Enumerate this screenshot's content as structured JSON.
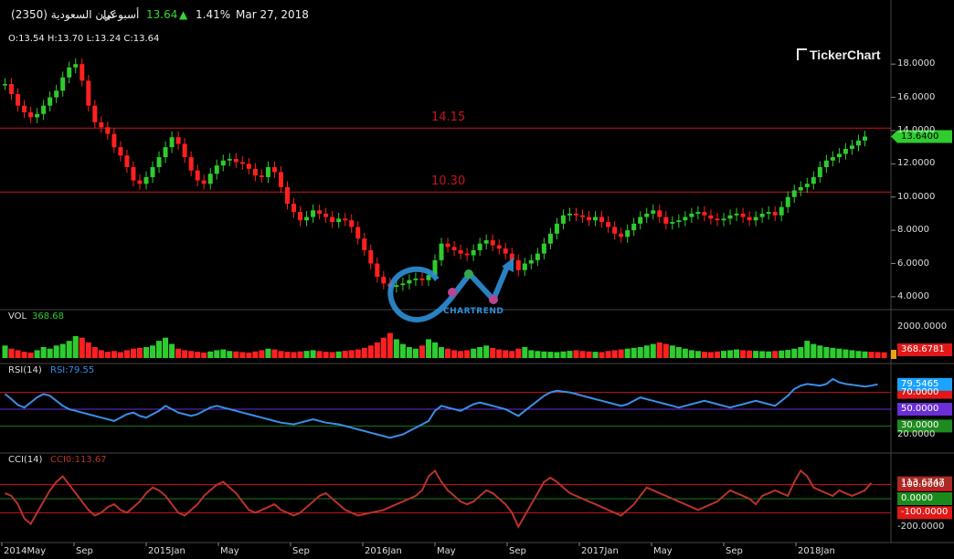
{
  "header": {
    "name": "كيان السعودية (2350)",
    "period": "أسبوعي",
    "price": "13.64",
    "change": "1.41%",
    "date": "Mar 27, 2018"
  },
  "ohlc": {
    "o": "O:13.54",
    "h": "H:13.70",
    "l": "L:13.24",
    "c": "C:13.64"
  },
  "brand": "TickerChart",
  "watermark": "CHARTREND",
  "colors": {
    "up": "#2ecc2e",
    "down": "#ff2020",
    "rsi": "#3a8ee6",
    "cci": "#b8332c",
    "level": "#c8141e"
  },
  "chart_data": {
    "type": "candlestick",
    "x_labels": [
      "2014May",
      "Sep",
      "2015Jan",
      "May",
      "Sep",
      "2016Jan",
      "May",
      "Sep",
      "2017Jan",
      "May",
      "Sep",
      "2018Jan"
    ],
    "price": {
      "y_ticks": [
        "18.0000",
        "16.0000",
        "14.0000",
        "12.0000",
        "10.0000",
        "8.0000",
        "6.0000",
        "4.0000"
      ],
      "ylim": [
        3.5,
        19
      ],
      "last_value": "13.6400",
      "levels": [
        {
          "label": "14.15",
          "value": 14.15
        },
        {
          "label": "10.30",
          "value": 10.3
        }
      ],
      "series": [
        16.8,
        16.2,
        15.5,
        15.1,
        14.8,
        15.0,
        15.5,
        16.0,
        16.4,
        17.2,
        17.8,
        18.0,
        17.0,
        15.5,
        14.5,
        14.2,
        13.8,
        13.0,
        12.5,
        11.8,
        11.0,
        10.8,
        11.2,
        11.8,
        12.4,
        13.0,
        13.6,
        13.2,
        12.4,
        11.6,
        11.0,
        10.8,
        11.4,
        11.9,
        12.2,
        12.3,
        12.1,
        12.0,
        11.7,
        11.3,
        11.2,
        11.8,
        11.5,
        10.6,
        9.6,
        9.1,
        8.6,
        8.8,
        9.2,
        9.0,
        8.8,
        8.5,
        8.7,
        8.6,
        8.2,
        7.5,
        6.8,
        6.0,
        5.2,
        4.8,
        4.6,
        4.7,
        4.8,
        5.0,
        5.1,
        5.0,
        5.3,
        6.2,
        7.2,
        7.0,
        6.8,
        6.6,
        6.5,
        6.8,
        7.2,
        7.4,
        7.1,
        6.9,
        6.6,
        6.2,
        5.6,
        6.0,
        6.2,
        6.6,
        7.2,
        7.8,
        8.4,
        8.9,
        9.0,
        8.9,
        8.8,
        8.6,
        8.8,
        8.5,
        8.2,
        7.8,
        7.6,
        8.0,
        8.4,
        8.8,
        9.0,
        9.2,
        8.8,
        8.4,
        8.5,
        8.6,
        8.8,
        9.0,
        9.1,
        8.9,
        8.7,
        8.6,
        8.7,
        8.9,
        9.0,
        8.8,
        8.6,
        8.8,
        9.0,
        9.1,
        8.9,
        9.4,
        10.0,
        10.4,
        10.6,
        10.8,
        11.2,
        11.8,
        12.2,
        12.4,
        12.6,
        12.9,
        13.1,
        13.4,
        13.64
      ]
    },
    "volume": {
      "label": "VOL",
      "value_label": "368.68",
      "y_ticks": [
        "2000.0000"
      ],
      "ylim": [
        0,
        2800
      ],
      "last_value": "368.6781",
      "values": [
        800,
        600,
        500,
        400,
        350,
        500,
        700,
        600,
        800,
        900,
        1100,
        1400,
        1300,
        1000,
        700,
        500,
        400,
        450,
        380,
        500,
        600,
        650,
        700,
        800,
        1100,
        1300,
        900,
        600,
        500,
        450,
        400,
        350,
        420,
        500,
        550,
        450,
        420,
        380,
        350,
        420,
        500,
        600,
        550,
        450,
        400,
        380,
        420,
        460,
        500,
        450,
        400,
        380,
        420,
        460,
        500,
        550,
        650,
        800,
        1000,
        1300,
        1600,
        1200,
        900,
        700,
        600,
        800,
        1200,
        1000,
        700,
        600,
        500,
        450,
        500,
        600,
        700,
        800,
        650,
        550,
        500,
        450,
        600,
        700,
        500,
        450,
        420,
        400,
        380,
        420,
        460,
        500,
        450,
        420,
        400,
        380,
        450,
        500,
        550,
        600,
        650,
        700,
        800,
        900,
        1000,
        900,
        800,
        700,
        600,
        500,
        450,
        400,
        380,
        420,
        460,
        500,
        550,
        500,
        480,
        460,
        440,
        420,
        450,
        480,
        520,
        600,
        700,
        1100,
        900,
        800,
        700,
        650,
        600,
        550,
        500,
        450,
        420,
        400,
        380,
        368.68
      ]
    },
    "rsi": {
      "label": "RSI(14)",
      "value_label": "RSI:79.55",
      "y_ticks": [
        "20.0000"
      ],
      "ylim": [
        0,
        100
      ],
      "last_value": "79.5465",
      "levels": [
        {
          "label": "70.0000",
          "value": 70
        },
        {
          "label": "50.0000",
          "value": 50
        },
        {
          "label": "30.0000",
          "value": 30
        }
      ],
      "values": [
        68,
        62,
        55,
        52,
        58,
        64,
        68,
        66,
        60,
        54,
        50,
        48,
        46,
        44,
        42,
        40,
        38,
        36,
        40,
        44,
        46,
        42,
        40,
        44,
        48,
        54,
        50,
        46,
        44,
        42,
        44,
        48,
        52,
        54,
        52,
        50,
        48,
        46,
        44,
        42,
        40,
        38,
        36,
        34,
        33,
        32,
        34,
        36,
        38,
        36,
        34,
        33,
        32,
        30,
        28,
        26,
        24,
        22,
        20,
        18,
        16,
        18,
        20,
        24,
        28,
        32,
        36,
        48,
        54,
        52,
        50,
        48,
        52,
        56,
        58,
        56,
        54,
        52,
        50,
        46,
        42,
        48,
        54,
        60,
        66,
        70,
        72,
        71,
        70,
        68,
        66,
        64,
        62,
        60,
        58,
        56,
        54,
        56,
        60,
        64,
        62,
        60,
        58,
        56,
        54,
        52,
        54,
        56,
        58,
        60,
        58,
        56,
        54,
        52,
        54,
        56,
        58,
        60,
        58,
        56,
        54,
        60,
        66,
        74,
        78,
        80,
        79,
        78,
        80,
        86,
        82,
        80,
        79,
        78,
        77,
        78,
        79.55
      ]
    },
    "cci": {
      "label": "CCI(14)",
      "value_label": "CCI0:113.67",
      "y_ticks": [
        "-200.0000"
      ],
      "ylim": [
        -300,
        300
      ],
      "last_value": "113.6747",
      "levels": [
        {
          "label": "100.0000",
          "value": 100
        },
        {
          "label": "0.0000",
          "value": 0
        },
        {
          "label": "-100.0000",
          "value": -100
        }
      ],
      "values": [
        40,
        20,
        -40,
        -140,
        -180,
        -100,
        -20,
        60,
        120,
        160,
        100,
        40,
        -20,
        -80,
        -120,
        -100,
        -60,
        -40,
        -80,
        -100,
        -60,
        -20,
        40,
        80,
        60,
        20,
        -40,
        -100,
        -120,
        -80,
        -40,
        20,
        60,
        100,
        120,
        80,
        40,
        -20,
        -80,
        -100,
        -80,
        -60,
        -40,
        -80,
        -100,
        -120,
        -100,
        -60,
        -20,
        20,
        40,
        0,
        -40,
        -80,
        -100,
        -120,
        -110,
        -100,
        -90,
        -80,
        -60,
        -40,
        -20,
        0,
        20,
        60,
        160,
        200,
        120,
        60,
        20,
        -20,
        -40,
        -20,
        20,
        60,
        40,
        0,
        -40,
        -100,
        -200,
        -120,
        -40,
        40,
        120,
        150,
        120,
        80,
        40,
        20,
        0,
        -20,
        -40,
        -60,
        -80,
        -100,
        -120,
        -80,
        -40,
        20,
        80,
        60,
        40,
        20,
        0,
        -20,
        -40,
        -60,
        -80,
        -60,
        -40,
        -20,
        20,
        60,
        40,
        20,
        0,
        -40,
        20,
        40,
        60,
        40,
        20,
        120,
        200,
        160,
        80,
        60,
        40,
        20,
        60,
        40,
        20,
        40,
        60,
        113.67
      ]
    }
  }
}
